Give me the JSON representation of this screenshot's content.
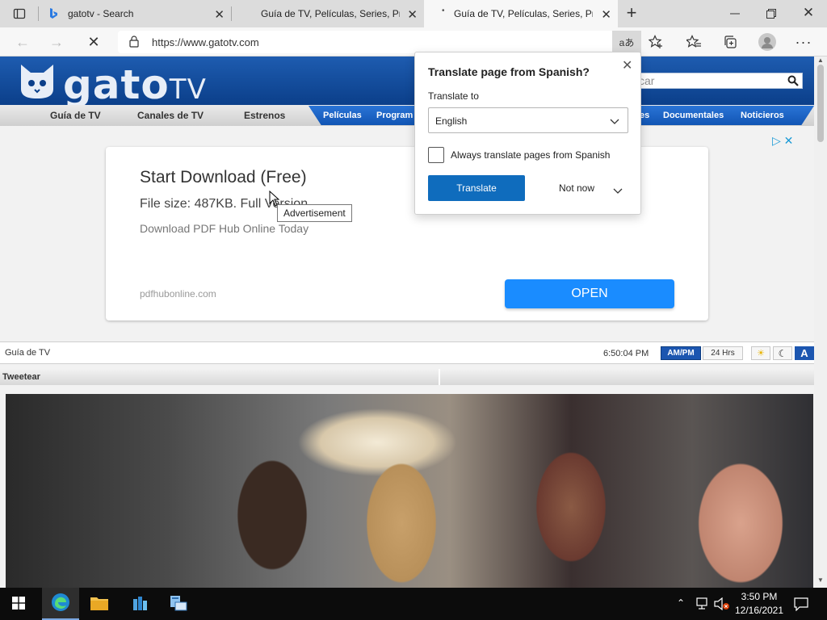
{
  "tabs": [
    {
      "title": "gatotv - Search"
    },
    {
      "title": "Guía de TV, Películas, Series, Prog"
    },
    {
      "title": "Guía de TV, Películas, Series, Prog"
    }
  ],
  "address": {
    "url": "https://www.gatotv.com"
  },
  "site": {
    "logo_main": "gato",
    "logo_tv": "TV",
    "search_placeholder": "car",
    "nav_gray": [
      "Guía de TV",
      "Canales de TV",
      "Estrenos"
    ],
    "nav_blue": [
      "Películas",
      "Program",
      "es",
      "Documentales",
      "Noticieros"
    ]
  },
  "ad": {
    "title": "Start Download (Free)",
    "size": "File size: 487KB. Full Version",
    "subtitle": "Download PDF Hub Online Today",
    "domain": "pdfhubonline.com",
    "open_label": "OPEN",
    "tooltip": "Advertisement"
  },
  "guide": {
    "label": "Guía de TV",
    "time": "6:50:04 PM",
    "ampm": "AM/PM",
    "hrs": "24 Hrs",
    "font_btn": "A"
  },
  "tweet": {
    "label": "Tweetear"
  },
  "translate": {
    "title": "Translate page from Spanish?",
    "to_label": "Translate to",
    "language": "English",
    "always_label": "Always translate pages from Spanish",
    "always_checked": false,
    "translate_btn": "Translate",
    "not_now": "Not now"
  },
  "taskbar": {
    "time": "3:50 PM",
    "date": "12/16/2021"
  },
  "colors": {
    "header_blue": "#0b3f8a",
    "nav_blue": "#1155b4",
    "primary_button": "#0f6cbd",
    "ad_open": "#1a8cff"
  }
}
